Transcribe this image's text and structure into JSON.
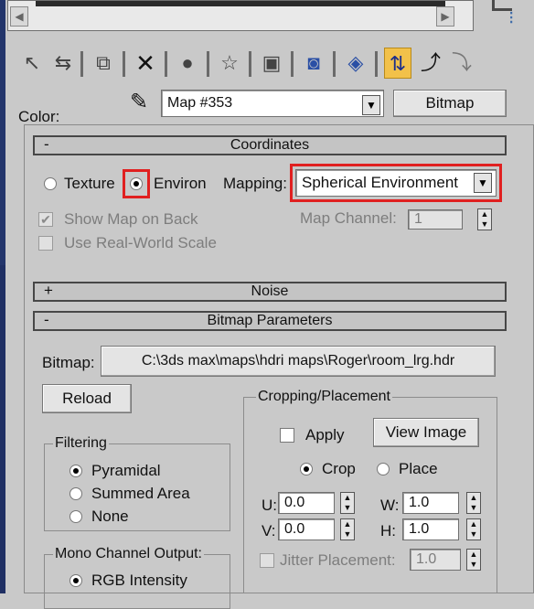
{
  "material": {
    "color_label": "Color:",
    "map_name": "Map #353",
    "map_type_button": "Bitmap"
  },
  "coordinates": {
    "title": "Coordinates",
    "collapse_sign": "-",
    "texture_label": "Texture",
    "environ_label": "Environ",
    "selected": "Environ",
    "mapping_label": "Mapping:",
    "mapping_value": "Spherical Environment",
    "show_map_on_back": "Show Map on Back",
    "show_map_on_back_checked": true,
    "use_real_world_scale": "Use Real-World Scale",
    "map_channel_label": "Map Channel:",
    "map_channel_value": "1"
  },
  "noise": {
    "title": "Noise",
    "expand_sign": "+"
  },
  "bitmap_params": {
    "title": "Bitmap Parameters",
    "collapse_sign": "-",
    "bitmap_label": "Bitmap:",
    "bitmap_path": "C:\\3ds max\\maps\\hdri maps\\Roger\\room_lrg.hdr",
    "reload_button": "Reload",
    "filtering": {
      "title": "Filtering",
      "options": [
        "Pyramidal",
        "Summed Area",
        "None"
      ],
      "selected": "Pyramidal"
    },
    "mono_channel": {
      "title": "Mono Channel Output:",
      "options": [
        "RGB Intensity"
      ],
      "selected": "RGB Intensity"
    },
    "cropping": {
      "title": "Cropping/Placement",
      "apply_label": "Apply",
      "view_image_button": "View Image",
      "crop_label": "Crop",
      "place_label": "Place",
      "selected": "Crop",
      "u_label": "U:",
      "u_value": "0.0",
      "v_label": "V:",
      "v_value": "0.0",
      "w_label": "W:",
      "w_value": "1.0",
      "h_label": "H:",
      "h_value": "1.0",
      "jitter_label": "Jitter Placement:",
      "jitter_value": "1.0"
    }
  },
  "colors": {
    "highlight": "#e02020",
    "active_tool": "#f2c14a",
    "background": "#c9c9c9"
  },
  "icons": [
    "scrollbar-left-arrow",
    "scrollbar-right-arrow",
    "get-material-icon",
    "put-to-scene-icon",
    "assign-material-icon",
    "reset-map-icon",
    "make-unique-icon",
    "put-to-library-icon",
    "material-effects-channel-icon",
    "show-map-in-viewport-icon",
    "show-end-result-icon",
    "go-to-parent-icon",
    "go-forward-icon",
    "eyedropper-icon"
  ]
}
